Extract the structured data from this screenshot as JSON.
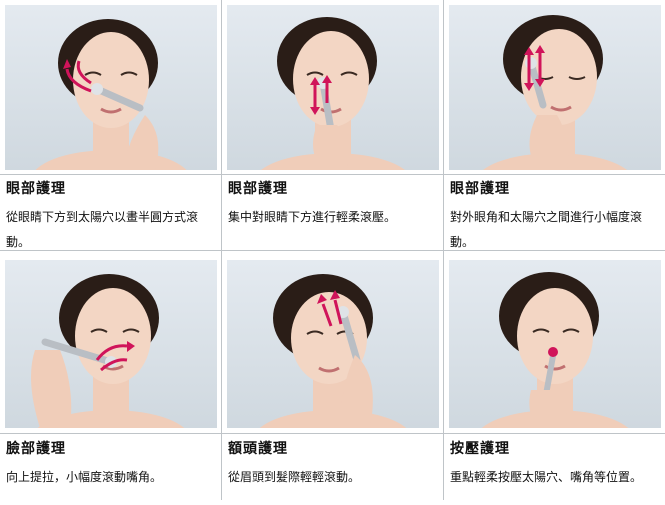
{
  "cards": [
    {
      "title": "眼部護理",
      "desc": "從眼睛下方到太陽穴以畫半圓方式滾動。"
    },
    {
      "title": "眼部護理",
      "desc": "集中對眼睛下方進行輕柔滾壓。"
    },
    {
      "title": "眼部護理",
      "desc": "對外眼角和太陽穴之間進行小幅度滾動。"
    },
    {
      "title": "臉部護理",
      "desc": "向上提拉，小幅度滾動嘴角。"
    },
    {
      "title": "額頭護理",
      "desc": "從眉頭到髮際輕輕滾動。"
    },
    {
      "title": "按壓護理",
      "desc": "重點輕柔按壓太陽穴、嘴角等位置。"
    }
  ],
  "colors": {
    "accent": "#d0145a",
    "skin": "#f3d6c4",
    "hair": "#2a1d17",
    "device": "#b9bec4"
  },
  "icons": [
    "arrow-icon",
    "roller-device-icon"
  ]
}
